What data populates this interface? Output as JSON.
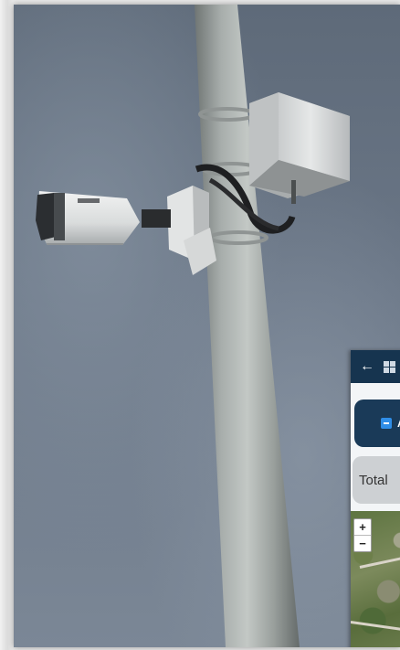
{
  "app": {
    "primary_button_label": "At",
    "total_label": "Total",
    "zoom_in": "+",
    "zoom_out": "−"
  },
  "icons": {
    "back": "arrow-left-icon",
    "menu": "grid-icon",
    "button": "minus-icon"
  }
}
